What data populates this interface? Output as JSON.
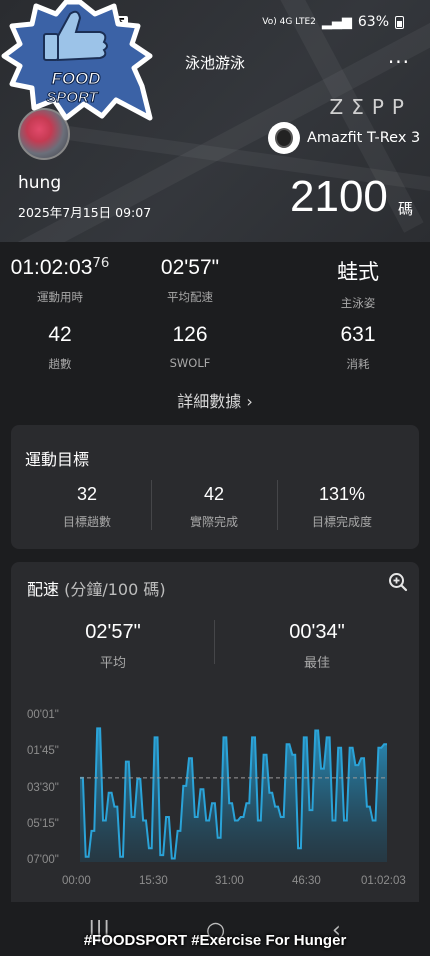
{
  "status_bar": {
    "network": "Vo) 4G LTE2",
    "battery": "63%"
  },
  "header": {
    "title": "泳池游泳",
    "more": "···",
    "brand": "ZΣPP",
    "device": "Amazfit T-Rex 3",
    "user": "hung",
    "datetime": "2025年7月15日 09:07",
    "distance": "2100",
    "distance_unit": "碼"
  },
  "badge": {
    "text_line1": "FOOD",
    "text_line2": "SPORT",
    "colors": {
      "fill": "#3b62a6",
      "border": "#ffffff",
      "thumb": "#9cc3e8"
    }
  },
  "stats": [
    {
      "value": "01:02:03",
      "sup": "76",
      "label": "運動用時"
    },
    {
      "value": "02'57\"",
      "sup": "",
      "label": "平均配速"
    },
    {
      "value": "蛙式",
      "sup": "",
      "label": "主泳姿"
    },
    {
      "value": "42",
      "sup": "",
      "label": "趟數"
    },
    {
      "value": "126",
      "sup": "",
      "label": "SWOLF"
    },
    {
      "value": "631",
      "sup": "",
      "label": "消耗"
    }
  ],
  "detail_link": "詳細數據 ›",
  "goal_card": {
    "title": "運動目標",
    "cells": [
      {
        "value": "32",
        "label": "目標趟數"
      },
      {
        "value": "42",
        "label": "實際完成"
      },
      {
        "value": "131%",
        "label": "目標完成度"
      }
    ]
  },
  "pace_card": {
    "title": "配速",
    "title_unit": "(分鐘/100 碼)",
    "average": {
      "value": "02'57\"",
      "label": "平均"
    },
    "best": {
      "value": "00'34\"",
      "label": "最佳"
    }
  },
  "chart_data": {
    "type": "area",
    "title": "",
    "xlabel": "",
    "ylabel": "",
    "y_ticks": [
      "00'01\"",
      "01'45\"",
      "03'30\"",
      "05'15\"",
      "07'00\""
    ],
    "x_ticks": [
      "00:00",
      "15:30",
      "31:00",
      "46:30",
      "01:02:03"
    ],
    "ylim_seconds": [
      1,
      420
    ],
    "y_inverted": true,
    "average_line_seconds": 177,
    "series": [
      {
        "color": "#2aa3d8",
        "values_seconds": [
          177,
          177,
          405,
          405,
          330,
          330,
          34,
          34,
          300,
          300,
          220,
          220,
          260,
          260,
          405,
          405,
          130,
          130,
          290,
          290,
          180,
          180,
          300,
          300,
          380,
          380,
          60,
          60,
          400,
          400,
          290,
          290,
          410,
          410,
          330,
          330,
          200,
          200,
          120,
          120,
          290,
          290,
          210,
          210,
          300,
          300,
          250,
          250,
          350,
          350,
          60,
          60,
          250,
          250,
          300,
          300,
          290,
          290,
          250,
          250,
          60,
          60,
          300,
          300,
          110,
          110,
          220,
          220,
          260,
          260,
          290,
          290,
          80,
          80,
          110,
          110,
          380,
          380,
          60,
          60,
          270,
          270,
          40,
          40,
          150,
          150,
          60,
          60,
          300,
          300,
          90,
          90,
          300,
          300,
          90,
          90,
          140,
          140,
          120,
          120,
          260,
          260,
          300,
          300,
          90,
          90,
          80,
          80
        ]
      }
    ]
  },
  "overlay": {
    "hashtag": "#FOODSPORT #Exercise For Hunger"
  },
  "navbar": {
    "recents": "|||",
    "home": "○",
    "back": "‹"
  }
}
